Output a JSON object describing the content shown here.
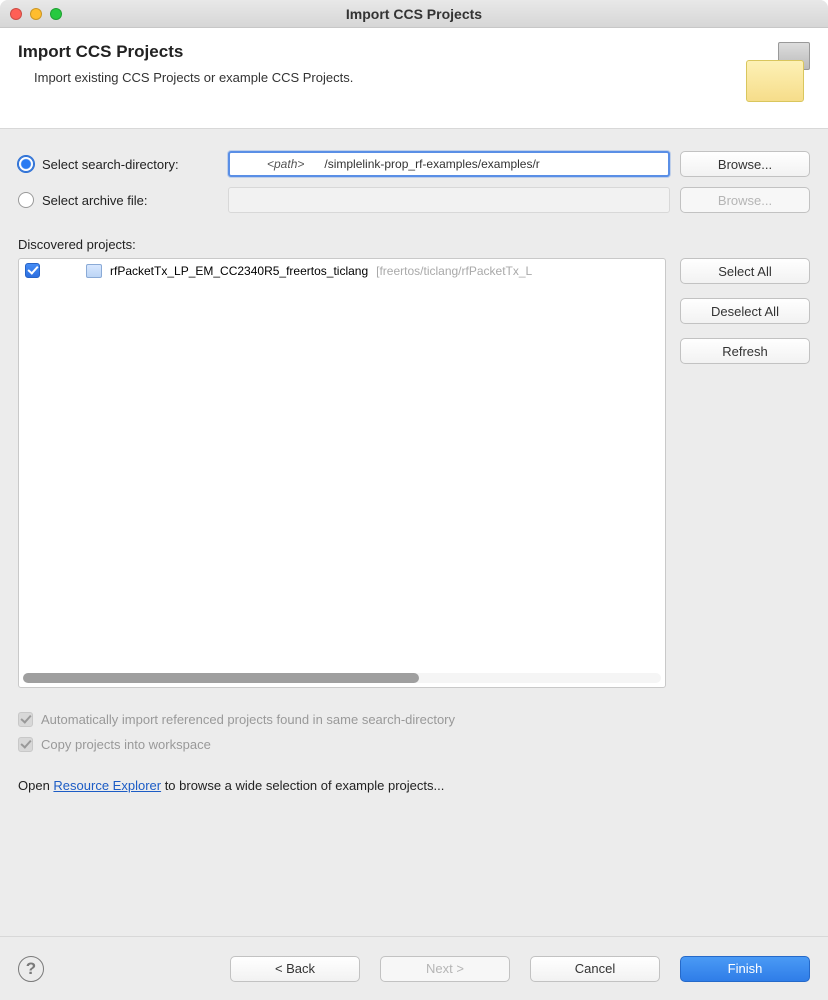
{
  "window": {
    "title": "Import CCS Projects"
  },
  "header": {
    "title": "Import CCS Projects",
    "subtitle": "Import existing CCS Projects or example CCS Projects."
  },
  "search": {
    "select_dir_label": "Select search-directory:",
    "select_archive_label": "Select archive file:",
    "path_prefix": "<path>",
    "path_value": "/simplelink-prop_rf-examples/examples/r",
    "browse_label": "Browse...",
    "browse2_label": "Browse..."
  },
  "discovered": {
    "label": "Discovered projects:",
    "items": [
      {
        "checked": true,
        "name": "rfPacketTx_LP_EM_CC2340R5_freertos_ticlang",
        "path": "[freertos/ticlang/rfPacketTx_L"
      }
    ],
    "select_all": "Select All",
    "deselect_all": "Deselect All",
    "refresh": "Refresh"
  },
  "options": {
    "auto_import": "Automatically import referenced projects found in same search-directory",
    "copy_projects": "Copy projects into workspace"
  },
  "open_line": {
    "pre": "Open ",
    "link": "Resource Explorer",
    "post": " to browse a wide selection of example projects..."
  },
  "footer": {
    "back": "< Back",
    "next": "Next >",
    "cancel": "Cancel",
    "finish": "Finish"
  }
}
